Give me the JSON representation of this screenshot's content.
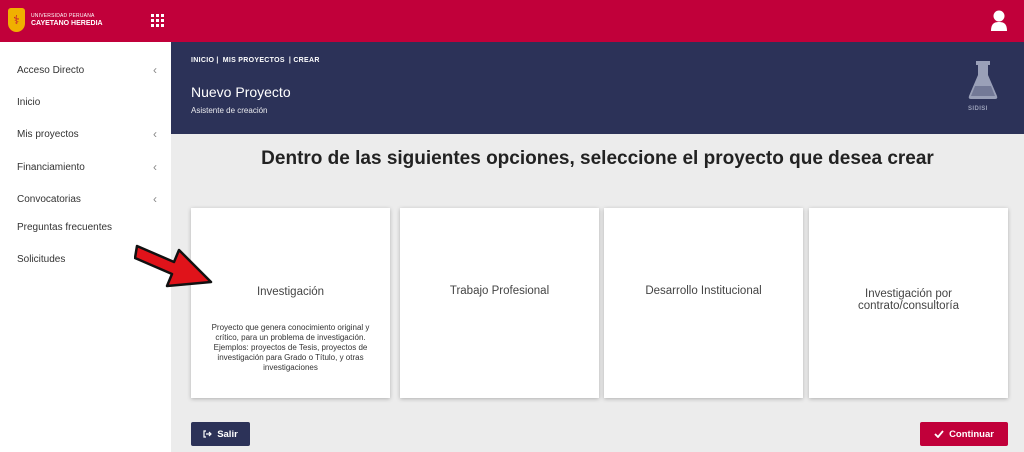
{
  "brand": {
    "line1": "UNIVERSIDAD PERUANA",
    "line2": "CAYETANO HEREDIA"
  },
  "sidebar": {
    "items": [
      {
        "label": "Acceso Directo",
        "chevron": "‹"
      },
      {
        "label": "Inicio",
        "chevron": ""
      },
      {
        "label": "Mis proyectos",
        "chevron": "‹"
      },
      {
        "label": "Financiamiento",
        "chevron": "‹"
      },
      {
        "label": "Convocatorias",
        "chevron": "‹"
      },
      {
        "label": "Preguntas frecuentes",
        "chevron": ""
      },
      {
        "label": "Solicitudes",
        "chevron": ""
      }
    ]
  },
  "header": {
    "breadcrumb": [
      "INICIO |",
      "MIS PROYECTOS",
      "| CREAR"
    ],
    "title": "Nuevo Proyecto",
    "subtitle": "Asistente de creación",
    "badge": "SIDISI"
  },
  "main": {
    "heading": "Dentro de las siguientes opciones, seleccione el proyecto que desea crear",
    "cards": [
      {
        "title": "Investigación",
        "description": "Proyecto que genera conocimiento original y crítico, para un problema de investigación. Ejemplos: proyectos de Tesis, proyectos de investigación para Grado o Título, y otras investigaciones"
      },
      {
        "title": "Trabajo Profesional",
        "description": ""
      },
      {
        "title": "Desarrollo Institucional",
        "description": ""
      },
      {
        "title": "Investigación por contrato/consultoría",
        "description": ""
      }
    ]
  },
  "buttons": {
    "exit": "Salir",
    "continue": "Continuar"
  },
  "colors": {
    "brand_red": "#c1003a",
    "navy": "#2c3258",
    "arrow_red": "#e0131a"
  },
  "icons": {
    "grid": "apps-grid-icon",
    "user": "user-icon",
    "flask": "flask-icon",
    "exit": "sign-out-icon",
    "check": "check-icon",
    "arrow": "pointer-arrow"
  }
}
